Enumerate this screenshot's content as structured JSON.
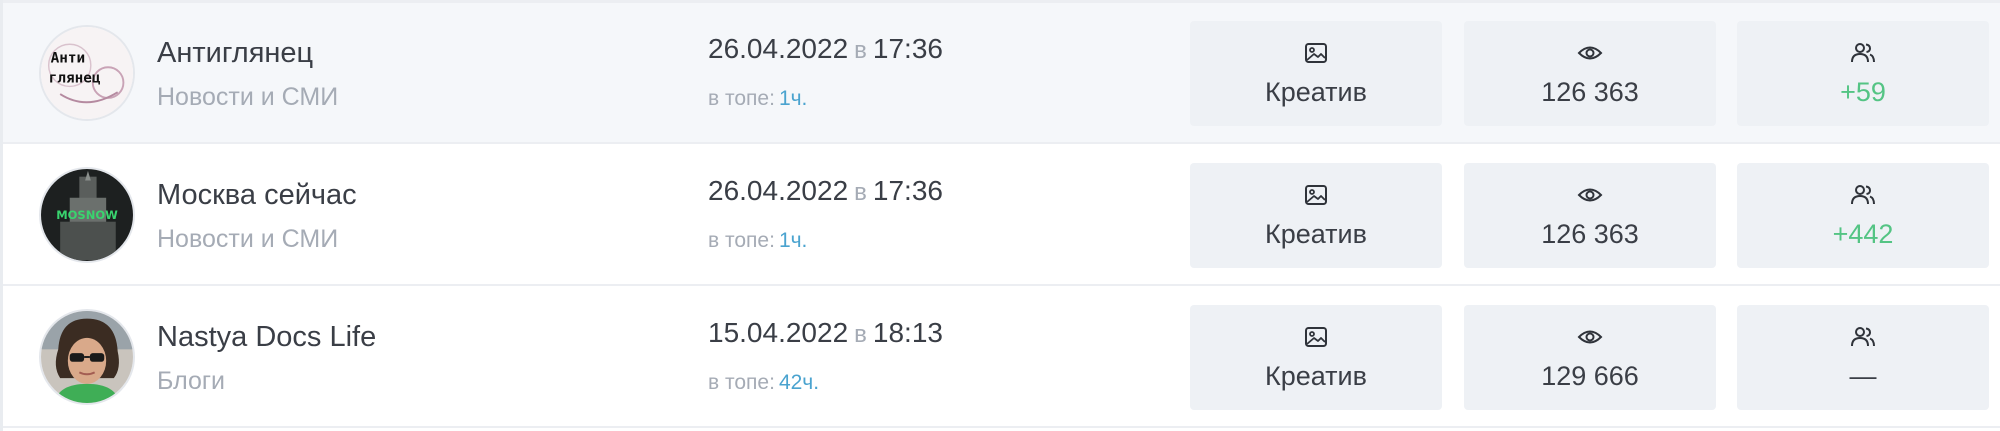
{
  "colors": {
    "accent_link": "#4aa3cf",
    "positive": "#54c484",
    "muted": "#a5abb5",
    "card_bg": "#eef1f5"
  },
  "icons": {
    "format": "image-icon",
    "views": "eye-icon",
    "subscribers": "users-icon"
  },
  "rows": [
    {
      "name": "Антиглянец",
      "category": "Новости и СМИ",
      "avatar_text_top": "Анти",
      "avatar_text_bottom": "глянец",
      "date": "26.04.2022",
      "sep": "в",
      "time": "17:36",
      "in_top_label": "в топе:",
      "in_top_value": "1ч.",
      "format": "Креатив",
      "views": "126 363",
      "subscribers": "+59"
    },
    {
      "name": "Москва сейчас",
      "category": "Новости и СМИ",
      "avatar_text_top": "MOSNOW",
      "avatar_text_bottom": "",
      "date": "26.04.2022",
      "sep": "в",
      "time": "17:36",
      "in_top_label": "в топе:",
      "in_top_value": "1ч.",
      "format": "Креатив",
      "views": "126 363",
      "subscribers": "+442"
    },
    {
      "name": "Nastya Docs Life",
      "category": "Блоги",
      "avatar_text_top": "",
      "avatar_text_bottom": "",
      "date": "15.04.2022",
      "sep": "в",
      "time": "18:13",
      "in_top_label": "в топе:",
      "in_top_value": "42ч.",
      "format": "Креатив",
      "views": "129 666",
      "subscribers": "—"
    }
  ]
}
